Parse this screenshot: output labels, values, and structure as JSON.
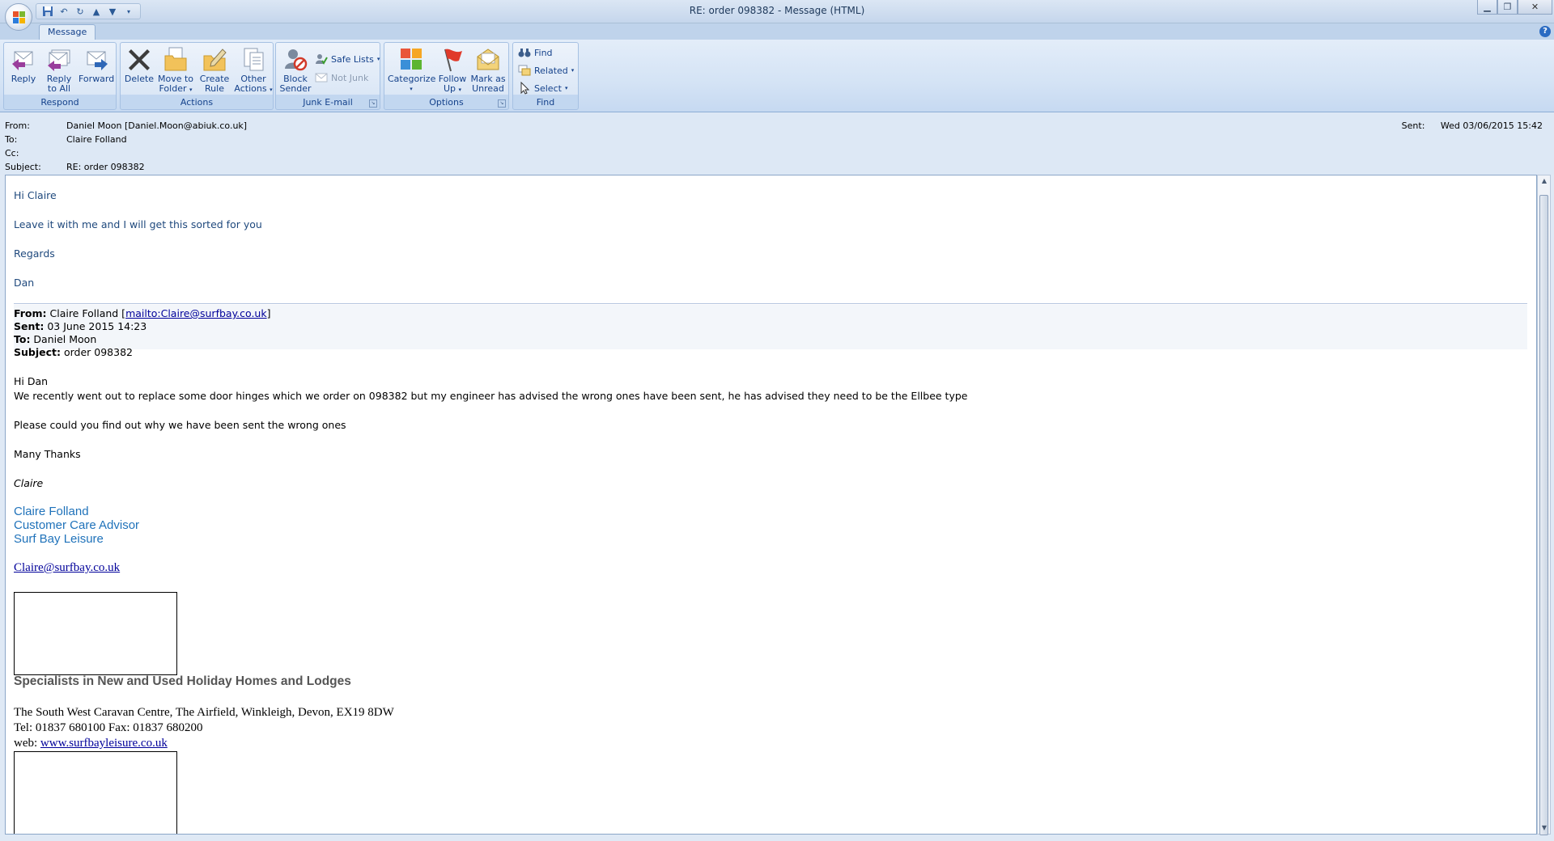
{
  "window": {
    "title": "RE: order 098382 - Message (HTML)"
  },
  "ribbon": {
    "tab": "Message",
    "groups": {
      "respond": "Respond",
      "actions": "Actions",
      "junk": "Junk E-mail",
      "options": "Options",
      "find": "Find"
    },
    "buttons": {
      "reply": "Reply",
      "reply_all_1": "Reply",
      "reply_all_2": "to All",
      "forward": "Forward",
      "delete": "Delete",
      "move_1": "Move to",
      "move_2": "Folder",
      "rule_1": "Create",
      "rule_2": "Rule",
      "other_1": "Other",
      "other_2": "Actions",
      "block_1": "Block",
      "block_2": "Sender",
      "safe_lists": "Safe Lists",
      "not_junk": "Not Junk",
      "categorize": "Categorize",
      "follow_1": "Follow",
      "follow_2": "Up",
      "mark_1": "Mark as",
      "mark_2": "Unread",
      "find": "Find",
      "related": "Related",
      "select": "Select"
    }
  },
  "header": {
    "from_label": "From:",
    "from_value": "Daniel Moon [Daniel.Moon@abiuk.co.uk]",
    "to_label": "To:",
    "to_value": "Claire Folland",
    "cc_label": "Cc:",
    "cc_value": "",
    "subject_label": "Subject:",
    "subject_value": "RE: order 098382",
    "sent_label": "Sent:",
    "sent_value": "Wed 03/06/2015 15:42"
  },
  "reply": {
    "greeting": "Hi Claire",
    "line1": "Leave it with me and I will get this sorted for you",
    "regards": "Regards",
    "name": "Dan"
  },
  "quoted": {
    "from_label": "From:",
    "from_name": " Claire Folland [",
    "from_link": "mailto:Claire@surfbay.co.uk",
    "from_close": "]",
    "sent_label": "Sent:",
    "sent_value": " 03 June 2015 14:23",
    "to_label": "To:",
    "to_value": " Daniel Moon",
    "subject_label": "Subject:",
    "subject_value": " order 098382",
    "greeting": "Hi Dan",
    "line1": "We recently went out to replace some door hinges which we order on 098382 but my engineer has advised the wrong ones have been sent, he has advised they need to be the Ellbee type",
    "line2": "Please could you find out why we have been sent the wrong ones",
    "thanks": "Many Thanks",
    "name_italic": "Claire",
    "sig_name": "Claire Folland",
    "sig_title": "Customer Care Advisor",
    "sig_company": "Surf Bay Leisure",
    "sig_email": "Claire@surfbay.co.uk",
    "tagline": "Specialists in New and Used Holiday Homes and Lodges",
    "address": "The South West Caravan Centre, The Airfield, Winkleigh, Devon, EX19 8DW",
    "tel": "Tel: 01837 680100  Fax: 01837 680200",
    "web_label": "web: ",
    "web_link": "www.surfbayleisure.co.uk"
  }
}
